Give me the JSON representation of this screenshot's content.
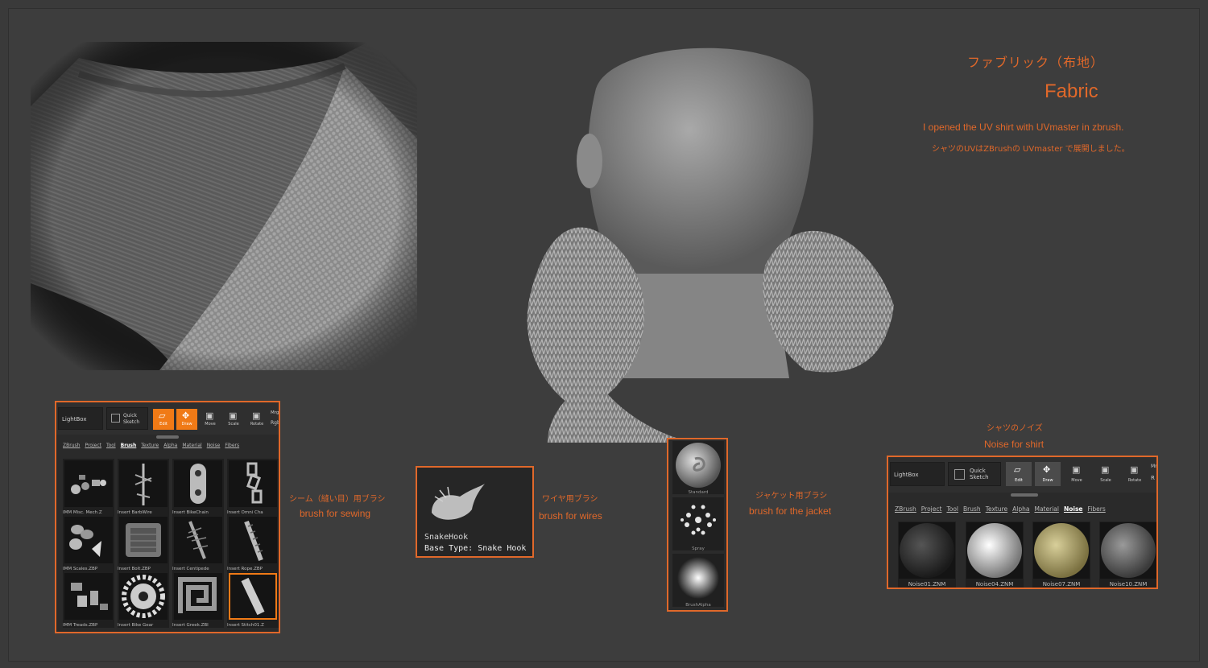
{
  "header": {
    "title_jp": "ファブリック（布地）",
    "title_en": "Fabric",
    "description_en": "I opened the UV shirt with UVmaster in zbrush.",
    "description_jp": "シャツのUVはZBrushの UVmaster で展開しました。"
  },
  "brush_panel": {
    "lightbox": "LightBox",
    "quick_sketch": "Quick\nSketch",
    "buttons": [
      "Edit",
      "Draw",
      "Move",
      "Scale",
      "Rotate"
    ],
    "extra_top": "Mrg",
    "extra_bottom": "Rgb",
    "tabs": [
      "ZBrush",
      "Project",
      "Tool",
      "Brush",
      "Texture",
      "Alpha",
      "Material",
      "Noise",
      "Fibers"
    ],
    "active_tab": "Brush",
    "items": [
      "IMM Misc. Mech.Z",
      "Insert BarbWire",
      "Insert BikeChain",
      "Insert Omni Cha",
      "IMM Scales.ZBP",
      "Insert Bolt.ZBP",
      "Insert Centipede",
      "Insert Rope.ZBP",
      "IMM Treads.ZBP",
      "Insert Bike Gear",
      "Insert Greek.ZBI",
      "Insert Stitch01.Z"
    ]
  },
  "sewing_caption": {
    "jp": "シーム（縫い目）用ブラシ",
    "en": "brush for sewing"
  },
  "snakehook": {
    "name": "SnakeHook",
    "base_type": "Base Type: Snake Hook"
  },
  "wires_caption": {
    "jp": "ワイヤ用ブラシ",
    "en": "brush for wires"
  },
  "jacket_brushes": {
    "items": [
      "Standard",
      "Spray",
      "BrushAlpha"
    ]
  },
  "jacket_caption": {
    "jp": "ジャケット用ブラシ",
    "en": "brush for the jacket"
  },
  "noise_caption": {
    "jp": "シャツのノイズ",
    "en": "Noise for shirt"
  },
  "noise_panel": {
    "lightbox": "LightBox",
    "quick_sketch": "Quick\nSketch",
    "buttons": [
      "Edit",
      "Draw",
      "Move",
      "Scale",
      "Rotate"
    ],
    "extra_top": "Mr",
    "extra_bottom": "R",
    "tabs": [
      "ZBrush",
      "Project",
      "Tool",
      "Brush",
      "Texture",
      "Alpha",
      "Material",
      "Noise",
      "Fibers"
    ],
    "active_tab": "Noise",
    "items": [
      "Noise01.ZNM",
      "Noise04.ZNM",
      "Noise07.ZNM",
      "Noise10.ZNM"
    ]
  },
  "colors": {
    "accent": "#e0682a",
    "bg": "#3d3d3d"
  }
}
